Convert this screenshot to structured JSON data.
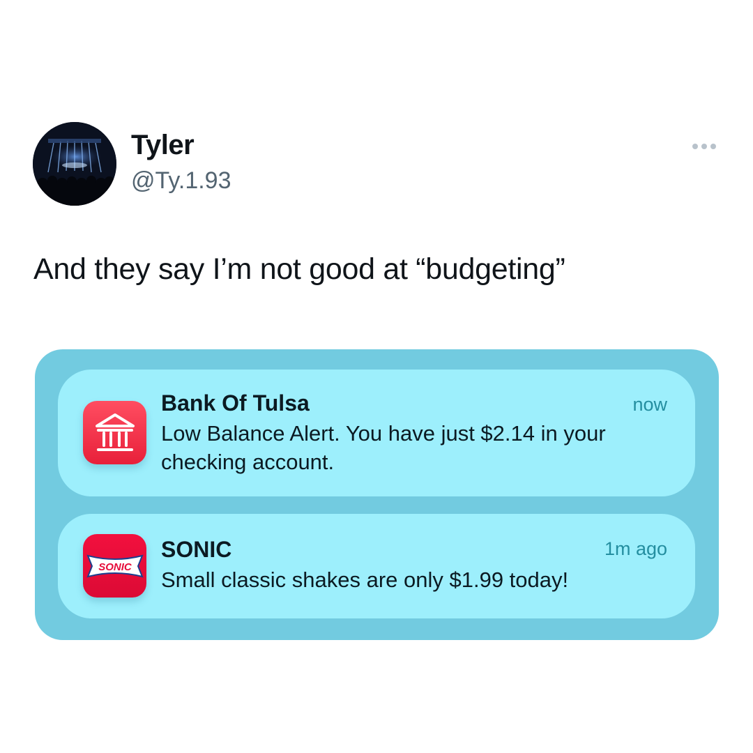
{
  "author": {
    "name": "Tyler",
    "handle": "@Ty.1.93",
    "avatar_icon": "concert-crowd-photo"
  },
  "more_icon": "more-horizontal-icon",
  "tweet": {
    "text": "And they say I’m not good at “budgeting”"
  },
  "notifications": [
    {
      "app": "Bank Of Tulsa",
      "time": "now",
      "body": "Low Balance Alert. You have just $2.14 in your checking account.",
      "icon": "bank-building-icon",
      "icon_color": "#f0283f"
    },
    {
      "app": "SONIC",
      "time": "1m ago",
      "body": "Small classic shakes are only $1.99 today!",
      "icon": "sonic-logo-icon",
      "icon_logo_text": "SONIC",
      "icon_color": "#e60c3a"
    }
  ],
  "colors": {
    "media_background": "#72cbe0",
    "notification_background": "#9deffc",
    "timestamp": "#248ea0"
  }
}
